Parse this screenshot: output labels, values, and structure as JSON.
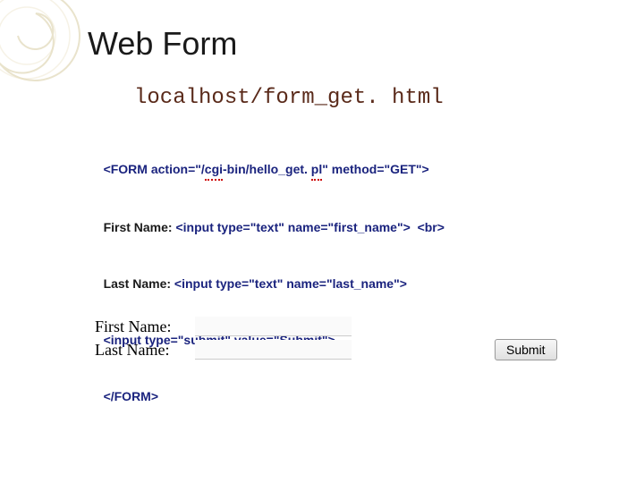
{
  "title": "Web Form",
  "path": "localhost/form_get. html",
  "code": {
    "line1": {
      "open_tag": "<FORM ",
      "action_attr": "action=\"/",
      "action_cgi": "cgi",
      "action_mid": "-bin/hello_get. ",
      "action_pl": "pl",
      "action_end": "\" method=\"GET\">"
    },
    "line2": {
      "label": "First Name: ",
      "tag": "<input type=\"text\" name=\"first_name\">  <br>"
    },
    "line3": "",
    "line4": {
      "label": "Last Name: ",
      "tag": "<input type=\"text\" name=\"last_name\">"
    },
    "line5": "<input type=\"submit\" value=\"Submit\">",
    "line6": "</FORM>"
  },
  "form": {
    "first_label": "First Name:",
    "last_label": "Last Name:",
    "first_value": "",
    "last_value": "",
    "submit_label": "Submit"
  }
}
